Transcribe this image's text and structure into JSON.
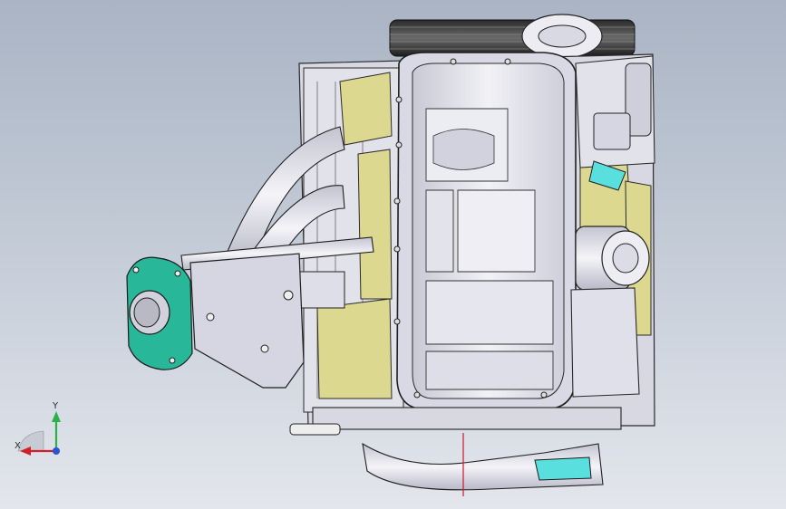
{
  "view": {
    "background_top": "#aab4c4",
    "background_bottom": "#e3e6ec",
    "model_colors": {
      "body": "#e6e6ee",
      "body_shade": "#c9c9d6",
      "outline": "#2a2a2a",
      "gasket": "#29b79a",
      "yellow_parts": "#dcd890",
      "cyan_part": "#59e0de",
      "section_line": "#d1152a"
    }
  },
  "triad": {
    "x_label": "X",
    "y_label": "Y",
    "x_color": "#d2202a",
    "y_color": "#2cb04a",
    "z_color": "#2a55cc",
    "x_icon": "x-axis-arrow-icon",
    "y_icon": "y-axis-arrow-icon",
    "z_icon": "z-axis-dot-icon"
  }
}
